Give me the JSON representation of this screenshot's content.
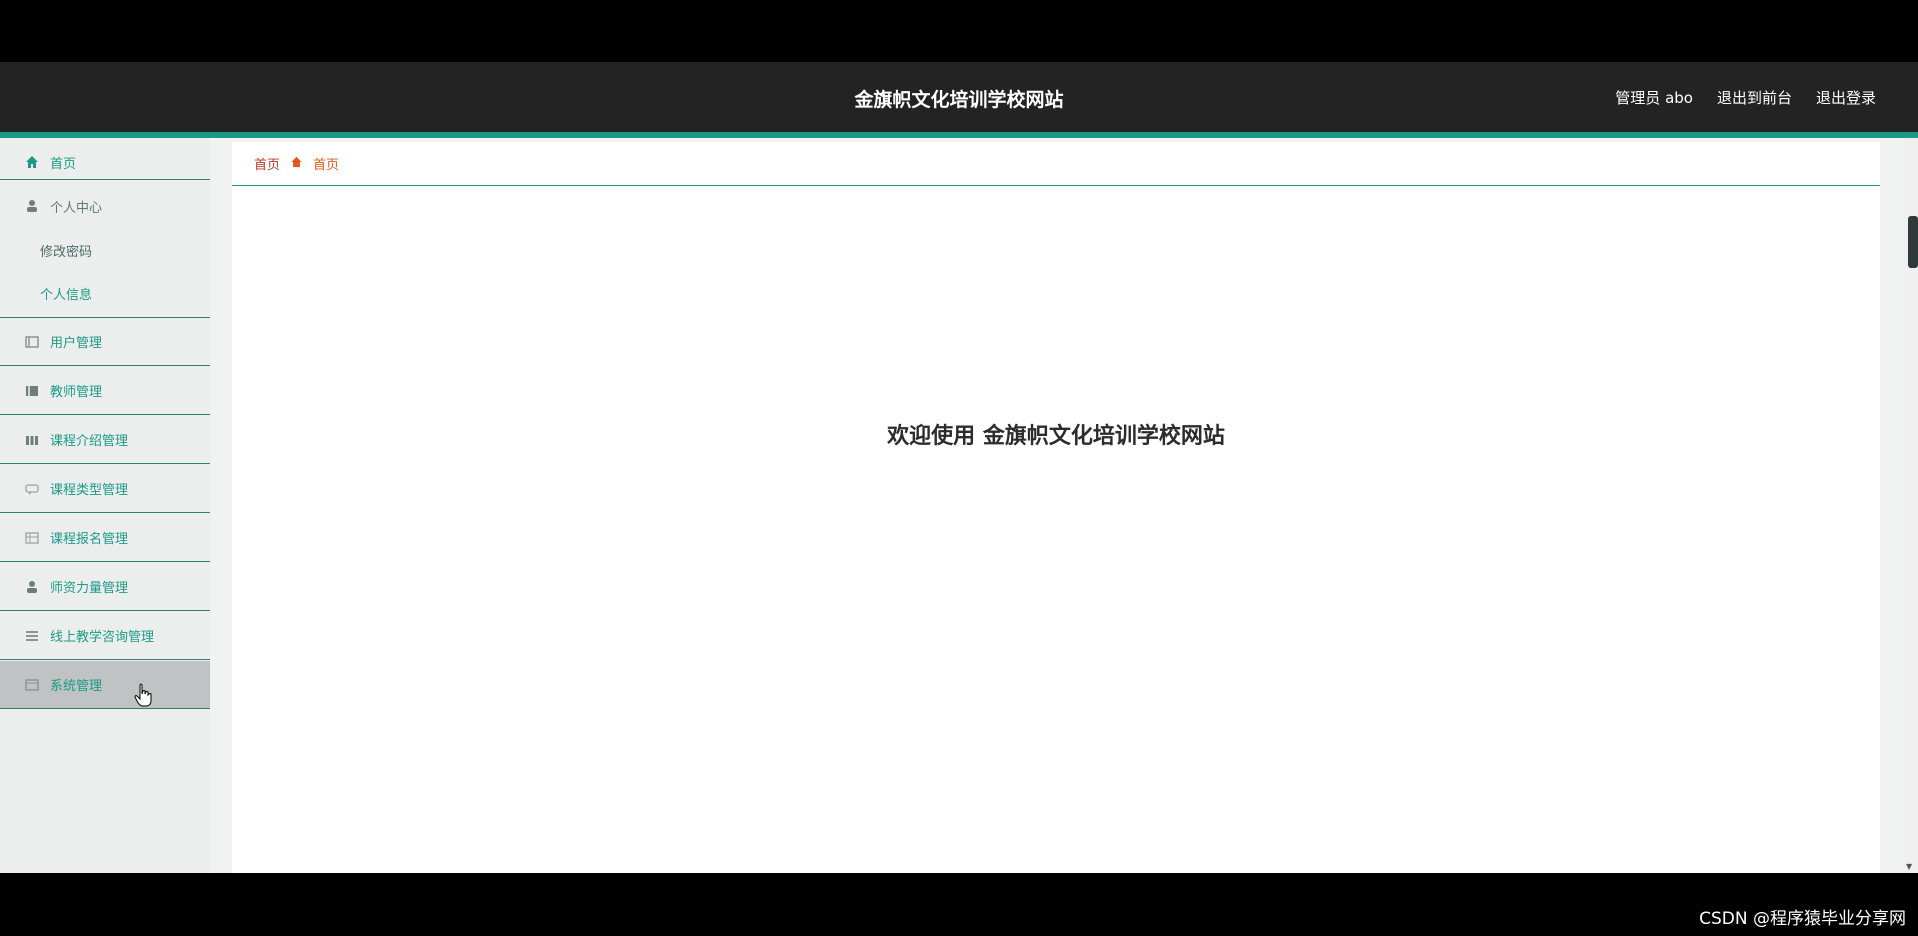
{
  "header": {
    "title": "金旗帜文化培训学校网站",
    "user": "管理员 abo",
    "to_front": "退出到前台",
    "logout": "退出登录"
  },
  "sidebar": {
    "items": [
      {
        "label": "首页",
        "icon": "home-icon"
      },
      {
        "label": "个人中心",
        "icon": "user-icon"
      },
      {
        "label": "修改密码",
        "icon": ""
      },
      {
        "label": "个人信息",
        "icon": ""
      },
      {
        "label": "用户管理",
        "icon": "list-icon"
      },
      {
        "label": "教师管理",
        "icon": "list-icon"
      },
      {
        "label": "课程介绍管理",
        "icon": "bars-icon"
      },
      {
        "label": "课程类型管理",
        "icon": "chat-icon"
      },
      {
        "label": "课程报名管理",
        "icon": "grid-icon"
      },
      {
        "label": "师资力量管理",
        "icon": "user-icon"
      },
      {
        "label": "线上教学咨询管理",
        "icon": "menu-icon"
      },
      {
        "label": "系统管理",
        "icon": "box-icon"
      }
    ]
  },
  "breadcrumb": {
    "home": "首页",
    "current": "首页"
  },
  "main": {
    "welcome": "欢迎使用 金旗帜文化培训学校网站"
  },
  "watermark": "CSDN @程序猿毕业分享网",
  "colors": {
    "accent": "#1c9a86",
    "header_bg": "#232323",
    "active_item_bg": "#bfc3c3"
  }
}
